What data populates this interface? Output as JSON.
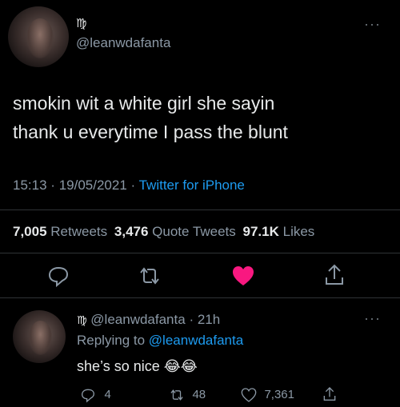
{
  "main_tweet": {
    "name_symbol": "♍",
    "handle": "@leanwdafanta",
    "text_line1": "smokin wit a white girl she sayin",
    "text_line2": "thank u everytime I pass the blunt",
    "time": "15:13",
    "date": "19/05/2021",
    "separator": "·",
    "source": "Twitter for iPhone",
    "retweets_count": "7,005",
    "retweets_label": "Retweets",
    "quotes_count": "3,476",
    "quotes_label": "Quote Tweets",
    "likes_count": "97.1K",
    "likes_label": "Likes",
    "more": "···"
  },
  "reply": {
    "name_symbol": "♍",
    "handle": "@leanwdafanta",
    "age": "· 21h",
    "replying_prefix": "Replying to",
    "replying_to": "@leanwdafanta",
    "text": "she’s so nice",
    "emoji": "😂😂",
    "reply_count": "4",
    "retweet_count": "48",
    "like_count": "7,361",
    "more": "···"
  },
  "colors": {
    "background": "#000000",
    "link": "#1d9bf0",
    "like_red": "#f91880",
    "muted": "#8b98a5"
  }
}
